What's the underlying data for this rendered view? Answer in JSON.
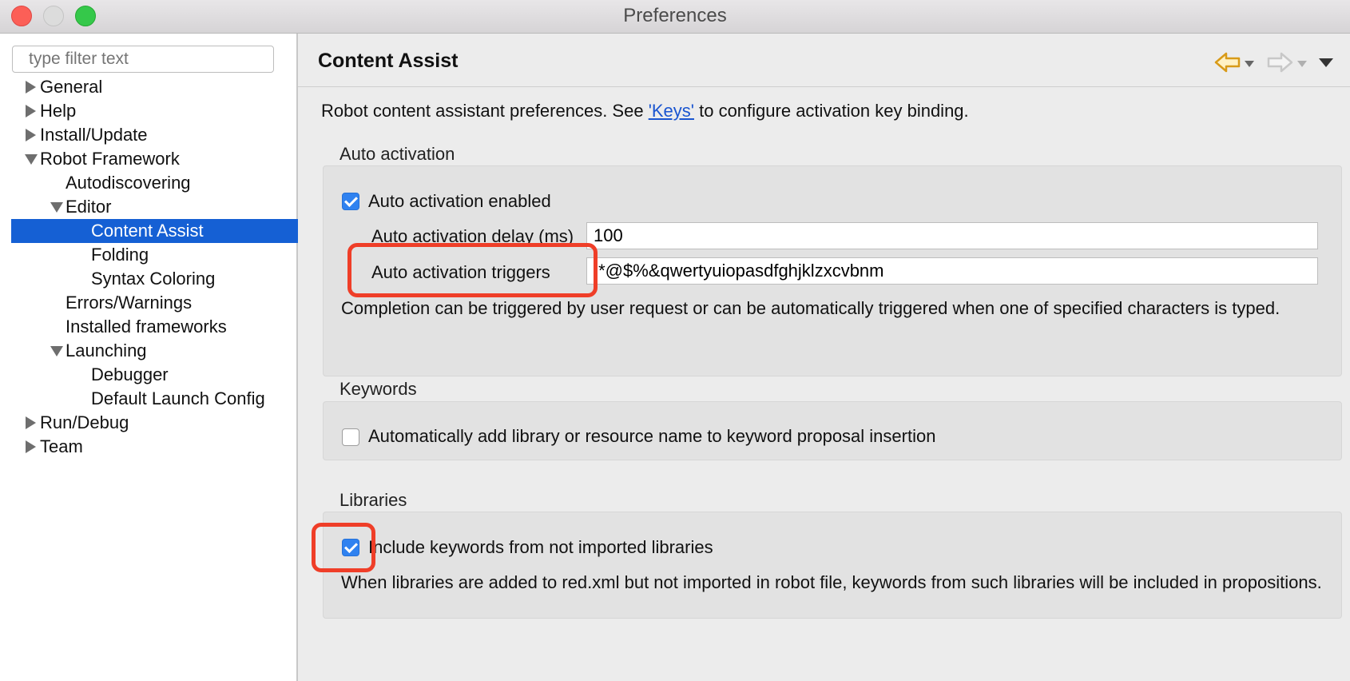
{
  "window": {
    "title": "Preferences"
  },
  "sidebar": {
    "filter_placeholder": "type filter text",
    "tree": [
      {
        "label": "General",
        "expander": "collapsed"
      },
      {
        "label": "Help",
        "expander": "collapsed"
      },
      {
        "label": "Install/Update",
        "expander": "collapsed"
      },
      {
        "label": "Robot Framework",
        "expander": "expanded"
      },
      {
        "label": "Autodiscovering",
        "expander": "none"
      },
      {
        "label": "Editor",
        "expander": "expanded"
      },
      {
        "label": "Content Assist",
        "expander": "none",
        "selected": true
      },
      {
        "label": "Folding",
        "expander": "none"
      },
      {
        "label": "Syntax Coloring",
        "expander": "none"
      },
      {
        "label": "Errors/Warnings",
        "expander": "none"
      },
      {
        "label": "Installed frameworks",
        "expander": "none"
      },
      {
        "label": "Launching",
        "expander": "expanded"
      },
      {
        "label": "Debugger",
        "expander": "none"
      },
      {
        "label": "Default Launch Config",
        "expander": "none"
      },
      {
        "label": "Run/Debug",
        "expander": "collapsed"
      },
      {
        "label": "Team",
        "expander": "collapsed"
      }
    ]
  },
  "main": {
    "title": "Content Assist",
    "nav_icons": [
      "back-arrow-icon",
      "forward-arrow-icon",
      "view-menu-icon"
    ],
    "description": {
      "before": "Robot content assistant preferences. See ",
      "link": "'Keys'",
      "after": " to configure activation key binding."
    },
    "auto_activation": {
      "label": "Auto activation",
      "enabled_label": "Auto activation enabled",
      "enabled_checked": true,
      "delay_label": "Auto activation delay (ms)",
      "delay_value": "100",
      "triggers_label": "Auto activation triggers",
      "triggers_value": ".*@$%&qwertyuiopasdfghjklzxcvbnm",
      "help": "Completion can be triggered by user request or can be automatically triggered when one of specified characters is typed."
    },
    "keywords": {
      "label": "Keywords",
      "add_library_label": "Automatically add library or resource name to keyword proposal insertion",
      "add_library_checked": false
    },
    "libraries": {
      "label": "Libraries",
      "include_label": "Include keywords from not imported libraries",
      "include_checked": true,
      "help": "When libraries are added to red.xml but not imported in robot file, keywords from such libraries will be included in propositions."
    }
  },
  "colors": {
    "selection": "#1560d4",
    "highlight": "#ef3e28",
    "checkbox_on": "#2f82f0"
  }
}
